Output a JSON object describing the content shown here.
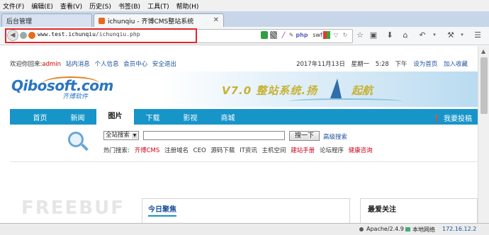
{
  "menu": [
    "文件(F)",
    "编辑(E)",
    "查看(V)",
    "历史(S)",
    "书签(B)",
    "工具(T)",
    "帮助(H)"
  ],
  "tabs": [
    {
      "label": "后台管理",
      "active": false
    },
    {
      "label": "ichunqiu - 齐博CMS整站系统",
      "active": true
    }
  ],
  "new_tab_glyph": "+",
  "address": {
    "host": "www.test.ichunqiu",
    "path": "/ichunqiu.php"
  },
  "toolbar_addons": [
    "php",
    "swf"
  ],
  "site": {
    "welcome": "欢迎你回来:",
    "user": "admin",
    "links": [
      "站内消息",
      "个人信息",
      "会员中心",
      "安全退出"
    ],
    "date": "2017年11月13日",
    "weekday": "星期一",
    "time": "5:28",
    "ampm": "下午",
    "set_home": "设为首页",
    "add_fav": "加入收藏",
    "logo": "Qibosoft.com",
    "logo_sub": "齐博软件",
    "banner_left": "V7.0 整站系统.扬",
    "banner_right": "起航",
    "nav": [
      "首页",
      "新闻",
      "图片",
      "下载",
      "影视",
      "商城"
    ],
    "active_nav": 2,
    "contribute": "❗ 我要投稿",
    "search_scope": "全站搜索",
    "search_button": "搜一下",
    "advanced": "高级搜索",
    "hot_label": "热门搜索:",
    "hot_terms": [
      {
        "text": "齐博CMS",
        "red": true
      },
      {
        "text": "注册域名",
        "red": false
      },
      {
        "text": "CEO",
        "red": false
      },
      {
        "text": "源码下载",
        "red": false
      },
      {
        "text": "IT资讯",
        "red": false
      },
      {
        "text": "主机空间",
        "red": false
      },
      {
        "text": "建站手册",
        "red": true
      },
      {
        "text": "论坛程序",
        "red": false
      },
      {
        "text": "健康咨询",
        "red": true
      }
    ],
    "box_today": "今日聚焦",
    "box_focus": "最爱关注",
    "watermark": "FREEBUF"
  },
  "status": {
    "server": "Apache/2.4.9",
    "network": "本地网络",
    "ip": "172.16.12.2"
  },
  "colors": {
    "nav_bar": "#1795c9",
    "link": "#1b4f9c",
    "highlight_box": "#e0262a",
    "accent_red": "#d0021b"
  }
}
